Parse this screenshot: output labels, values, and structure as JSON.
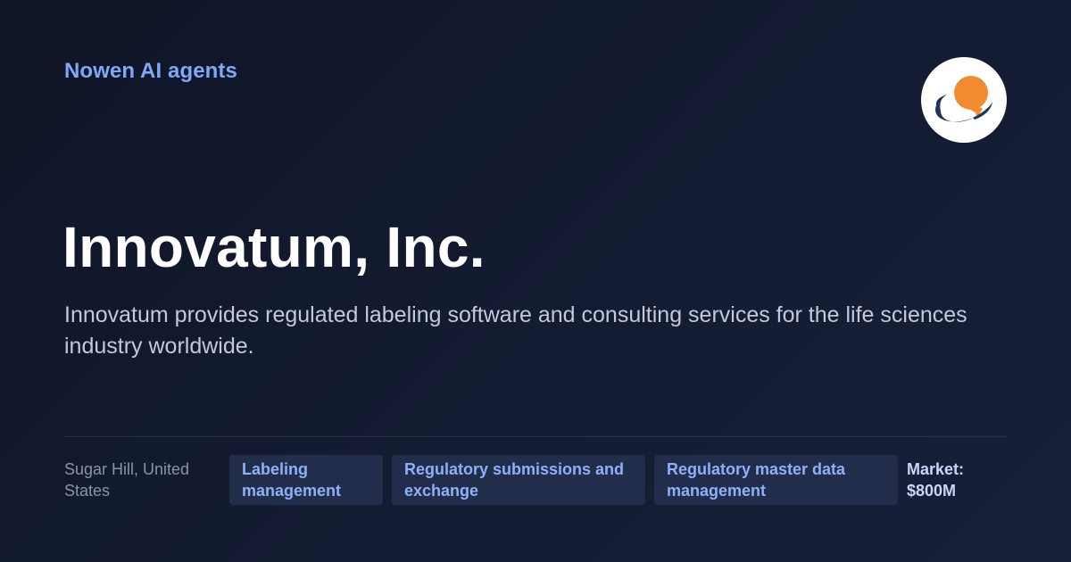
{
  "header": {
    "brand": "Nowen AI agents"
  },
  "company": {
    "name": "Innovatum, Inc.",
    "description": "Innovatum provides regulated labeling software and consulting services for the life sciences industry worldwide.",
    "logo_icon": "lightbulb-swoosh-logo",
    "location": "Sugar Hill, United States",
    "tags": [
      "Labeling management",
      "Regulatory submissions and exchange",
      "Regulatory master data management"
    ],
    "market": "Market: $800M"
  },
  "colors": {
    "background": "#121a2e",
    "brand_text": "#7fa8f7",
    "tag_background": "#222d4b",
    "tag_text": "#8fb0f7",
    "logo_orange": "#f28a2e",
    "logo_navy": "#1f3557"
  }
}
